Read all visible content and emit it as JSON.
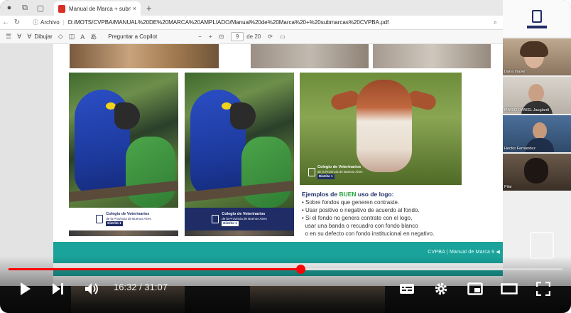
{
  "browser": {
    "tab_title": "Manual de Marca + submarcas C",
    "tab_close": "×",
    "new_tab": "+",
    "address_info": "Archivo",
    "url": "D:/MOTS/CVPBA/MANUAL%20DE%20MARCA%20AMPLIADO/Manual%20de%20Marca%20+%20submarcas%20CVPBA.pdf"
  },
  "pdf_toolbar": {
    "draw_label": "Dibujar",
    "copilot_label": "Preguntar a Copilot",
    "zoom_out": "−",
    "zoom_in": "+",
    "page_current": "9",
    "page_total": "de 20"
  },
  "page": {
    "logo_title": "Colegio de Veterinarios",
    "logo_sub": "de la Provincia de Buenos Aires",
    "logo_district": "Distrito 1",
    "examples": {
      "title_pre": "Ejemplos de ",
      "title_hl": "BUEN",
      "title_post": " uso de logo:",
      "lines": [
        "• Sobre fondos que generen contraste.",
        "• Usar positivo o negativo de acuerdo al fondo.",
        "• Si el fondo no genera contrate con el logo,",
        "  usar una banda o recuadro con fondo blanco",
        "  o en su defecto con fondo institucional en negativo."
      ]
    },
    "footer": "CVPBA | Manual de Marca 9 ◀"
  },
  "participants": [
    {
      "name": ""
    },
    {
      "name": "Dana mayer"
    },
    {
      "name": "MARIO DANIEL Jauglardi"
    },
    {
      "name": "Hector Fernandez"
    },
    {
      "name": "Pilar"
    }
  ],
  "player": {
    "time_current": "16:32",
    "time_total": "31:07",
    "time_sep": " / ",
    "progress": 0.527,
    "accent": "#ff0000"
  }
}
